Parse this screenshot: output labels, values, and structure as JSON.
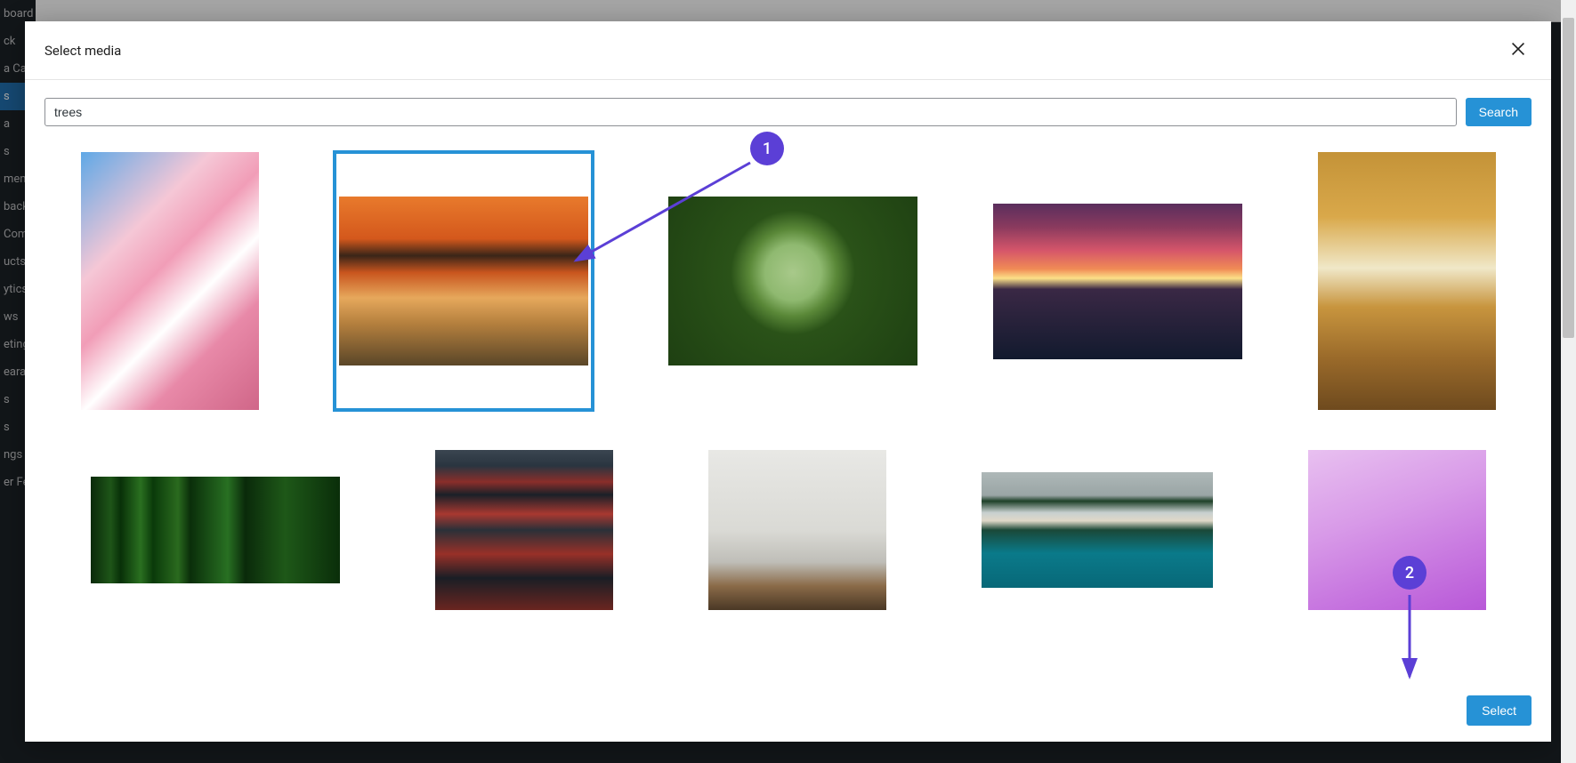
{
  "modal": {
    "title": "Select media",
    "close_name": "close-icon"
  },
  "search": {
    "value": "trees",
    "button_label": "Search"
  },
  "footer": {
    "select_label": "Select"
  },
  "annotations": {
    "badge1": "1",
    "badge2": "2"
  },
  "sidebar": {
    "items": [
      "board",
      "ck",
      "a Ca",
      "s",
      "a",
      "s",
      "ment",
      "back",
      "Com",
      "ucts",
      "ytics",
      "ws",
      "eting",
      "earan",
      "s",
      "s",
      "ngs",
      "er Fe"
    ]
  }
}
